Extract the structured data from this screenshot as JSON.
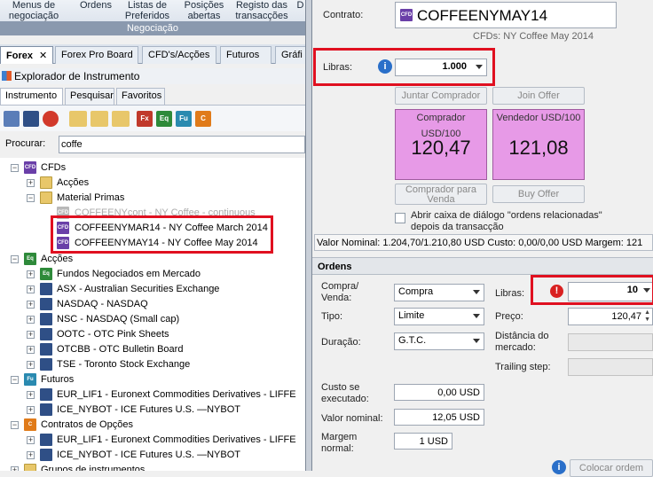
{
  "ribbon": {
    "items": [
      "Menus de negociação",
      "Ordens",
      "Listas de Preferidos",
      "Posições abertas",
      "Registo das transacções"
    ],
    "group_label": "Negociação",
    "partial": "D"
  },
  "tabs": [
    "Forex",
    "Forex Pro Board",
    "CFD's/Acções",
    "Futuros",
    "Gráfi"
  ],
  "explorer": {
    "title": "Explorador de Instrumento",
    "subtabs": [
      "Instrumento",
      "Pesquisar",
      "Favoritos"
    ],
    "search_label": "Procurar:",
    "search_value": "coffe"
  },
  "toolbar_icons": [
    "Fx",
    "Eq",
    "Fu",
    "C"
  ],
  "tree": {
    "cfds": "CFDs",
    "accoes_sub": "Acções",
    "material": "Material Primas",
    "cont": "COFFEENYcont - NY Coffee - continuous",
    "mar": "COFFEENYMAR14 - NY Coffee March 2014",
    "may": "COFFEENYMAY14 - NY Coffee May 2014",
    "accoes": "Acções",
    "fundos": "Fundos Negociados em Mercado",
    "markets": [
      "ASX - Australian Securities Exchange",
      "NASDAQ - NASDAQ",
      "NSC - NASDAQ (Small cap)",
      "OOTC - OTC Pink Sheets",
      "OTCBB - OTC Bulletin Board",
      "TSE - Toronto Stock Exchange"
    ],
    "futuros": "Futuros",
    "fut_markets": [
      "EUR_LIF1 - Euronext Commodities Derivatives - LIFFE",
      "ICE_NYBOT - ICE Futures U.S. —NYBOT"
    ],
    "opcoes": "Contratos de Opções",
    "opt_markets": [
      "EUR_LIF1 - Euronext Commodities Derivatives - LIFFE",
      "ICE_NYBOT - ICE Futures U.S. —NYBOT"
    ],
    "grupos": "Grupos de instrumentos"
  },
  "ticket": {
    "contrato_label": "Contrato:",
    "contract": "COFFEENYMAY14",
    "contract_desc": "CFDs: NY Coffee May 2014",
    "libras_label": "Libras:",
    "libras_value": "1.000",
    "juntar_comprador": "Juntar Comprador",
    "join_offer": "Join Offer",
    "buy_head": "Comprador USD/100",
    "buy_value": "120,47",
    "sell_head": "Vendedor USD/100",
    "sell_value": "121,08",
    "comprador_venda": "Comprador para Venda",
    "buy_offer": "Buy Offer",
    "checkbox_label": "Abrir caixa de diálogo \"ordens relacionadas\" depois da transacção",
    "status": "Valor Nominal: 1.204,70/1.210,80 USD   Custo: 0,00/0,00 USD   Margem: 121"
  },
  "orders": {
    "title": "Ordens",
    "compra_label": "Compra/ Venda:",
    "compra_value": "Compra",
    "libras_label": "Libras:",
    "libras_value": "10",
    "tipo_label": "Tipo:",
    "tipo_value": "Limite",
    "preco_label": "Preço:",
    "preco_value": "120,47",
    "duracao_label": "Duração:",
    "duracao_value": "G.T.C.",
    "distancia_label": "Distância do mercado:",
    "trailing_label": "Trailing step:",
    "custo_label": "Custo se executado:",
    "custo_value": "0,00 USD",
    "nominal_label": "Valor nominal:",
    "nominal_value": "12,05 USD",
    "margem_label": "Margem normal:",
    "margem_value": "1 USD",
    "colocar": "Colocar ordem"
  }
}
